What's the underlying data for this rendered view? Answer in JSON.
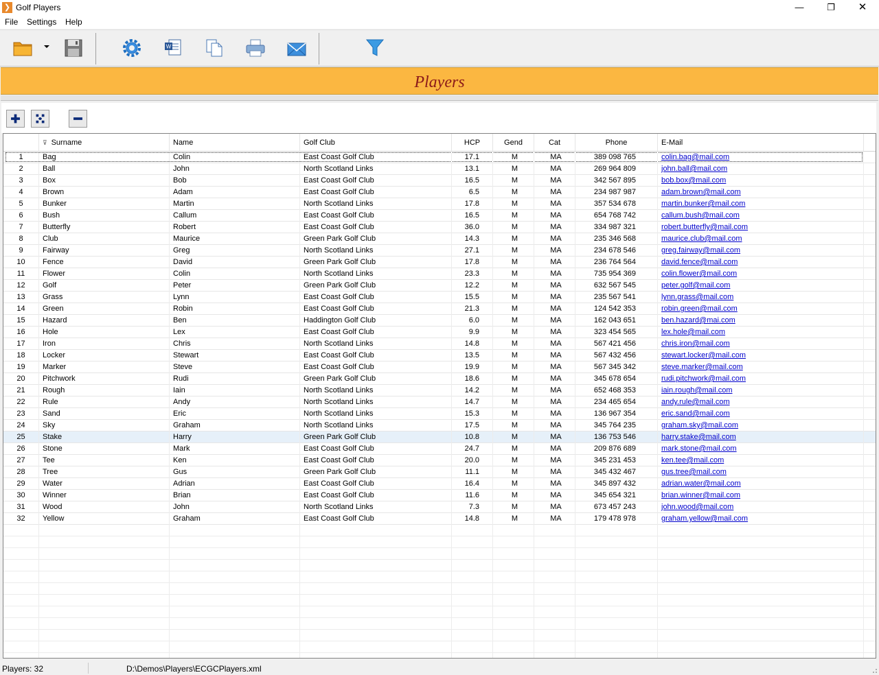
{
  "window": {
    "title": "Golf Players"
  },
  "menu": [
    "File",
    "Settings",
    "Help"
  ],
  "banner": {
    "title": "Players"
  },
  "grid": {
    "columns": {
      "num": "",
      "surname": "Surname",
      "name": "Name",
      "club": "Golf Club",
      "hcp": "HCP",
      "gend": "Gend",
      "cat": "Cat",
      "phone": "Phone",
      "email": "E-Mail"
    },
    "selected_row": 25,
    "focused_row": 1,
    "rows": [
      {
        "num": "1",
        "surname": "Bag",
        "name": "Colin",
        "club": "East Coast Golf Club",
        "hcp": "17.1",
        "gend": "M",
        "cat": "MA",
        "phone": "389 098 765",
        "email": "colin.bag@mail.com"
      },
      {
        "num": "2",
        "surname": "Ball",
        "name": "John",
        "club": "North Scotland Links",
        "hcp": "13.1",
        "gend": "M",
        "cat": "MA",
        "phone": "269 964 809",
        "email": "john.ball@mail.com"
      },
      {
        "num": "3",
        "surname": "Box",
        "name": "Bob",
        "club": "East Coast Golf Club",
        "hcp": "16.5",
        "gend": "M",
        "cat": "MA",
        "phone": "342 567 895",
        "email": "bob.box@mail.com"
      },
      {
        "num": "4",
        "surname": "Brown",
        "name": "Adam",
        "club": "East Coast Golf Club",
        "hcp": "6.5",
        "gend": "M",
        "cat": "MA",
        "phone": "234 987 987",
        "email": "adam.brown@mail.com"
      },
      {
        "num": "5",
        "surname": "Bunker",
        "name": "Martin",
        "club": "North Scotland Links",
        "hcp": "17.8",
        "gend": "M",
        "cat": "MA",
        "phone": "357 534 678",
        "email": "martin.bunker@mail.com"
      },
      {
        "num": "6",
        "surname": "Bush",
        "name": "Callum",
        "club": "East Coast Golf Club",
        "hcp": "16.5",
        "gend": "M",
        "cat": "MA",
        "phone": "654 768 742",
        "email": "callum.bush@mail.com"
      },
      {
        "num": "7",
        "surname": "Butterfly",
        "name": "Robert",
        "club": "East Coast Golf Club",
        "hcp": "36.0",
        "gend": "M",
        "cat": "MA",
        "phone": "334 987 321",
        "email": "robert.butterfly@mail.com"
      },
      {
        "num": "8",
        "surname": "Club",
        "name": "Maurice",
        "club": "Green Park Golf Club",
        "hcp": "14.3",
        "gend": "M",
        "cat": "MA",
        "phone": "235 346 568",
        "email": "maurice.club@mail.com"
      },
      {
        "num": "9",
        "surname": "Fairway",
        "name": "Greg",
        "club": "North Scotland Links",
        "hcp": "27.1",
        "gend": "M",
        "cat": "MA",
        "phone": "234 678 546",
        "email": "greg.fairway@mail.com"
      },
      {
        "num": "10",
        "surname": "Fence",
        "name": "David",
        "club": "Green Park Golf Club",
        "hcp": "17.8",
        "gend": "M",
        "cat": "MA",
        "phone": "236 764 564",
        "email": "david.fence@mail.com"
      },
      {
        "num": "11",
        "surname": "Flower",
        "name": "Colin",
        "club": "North Scotland Links",
        "hcp": "23.3",
        "gend": "M",
        "cat": "MA",
        "phone": "735 954 369",
        "email": "colin.flower@mail.com"
      },
      {
        "num": "12",
        "surname": "Golf",
        "name": "Peter",
        "club": "Green Park Golf Club",
        "hcp": "12.2",
        "gend": "M",
        "cat": "MA",
        "phone": "632 567 545",
        "email": "peter.golf@mail.com"
      },
      {
        "num": "13",
        "surname": "Grass",
        "name": "Lynn",
        "club": "East Coast Golf Club",
        "hcp": "15.5",
        "gend": "M",
        "cat": "MA",
        "phone": "235 567 541",
        "email": "lynn.grass@mail.com"
      },
      {
        "num": "14",
        "surname": "Green",
        "name": "Robin",
        "club": "East Coast Golf Club",
        "hcp": "21.3",
        "gend": "M",
        "cat": "MA",
        "phone": "124 542 353",
        "email": "robin.green@mail.com"
      },
      {
        "num": "15",
        "surname": "Hazard",
        "name": "Ben",
        "club": "Haddington Golf Club",
        "hcp": "6.0",
        "gend": "M",
        "cat": "MA",
        "phone": "162 043 651",
        "email": "ben.hazard@mai.com"
      },
      {
        "num": "16",
        "surname": "Hole",
        "name": "Lex",
        "club": "East Coast Golf Club",
        "hcp": "9.9",
        "gend": "M",
        "cat": "MA",
        "phone": "323 454 565",
        "email": "lex.hole@mail.com"
      },
      {
        "num": "17",
        "surname": "Iron",
        "name": "Chris",
        "club": "North Scotland Links",
        "hcp": "14.8",
        "gend": "M",
        "cat": "MA",
        "phone": "567 421 456",
        "email": "chris.iron@mail.com"
      },
      {
        "num": "18",
        "surname": "Locker",
        "name": "Stewart",
        "club": "East Coast Golf Club",
        "hcp": "13.5",
        "gend": "M",
        "cat": "MA",
        "phone": "567 432 456",
        "email": "stewart.locker@mail.com"
      },
      {
        "num": "19",
        "surname": "Marker",
        "name": "Steve",
        "club": "East Coast Golf Club",
        "hcp": "19.9",
        "gend": "M",
        "cat": "MA",
        "phone": "567 345 342",
        "email": "steve.marker@mail.com"
      },
      {
        "num": "20",
        "surname": "Pitchwork",
        "name": "Rudi",
        "club": "Green Park Golf Club",
        "hcp": "18.6",
        "gend": "M",
        "cat": "MA",
        "phone": "345 678 654",
        "email": "rudi.pitchwork@mail.com"
      },
      {
        "num": "21",
        "surname": "Rough",
        "name": "Iain",
        "club": "North Scotland Links",
        "hcp": "14.2",
        "gend": "M",
        "cat": "MA",
        "phone": "652 468 353",
        "email": "iain.rough@mail.com"
      },
      {
        "num": "22",
        "surname": "Rule",
        "name": "Andy",
        "club": "North Scotland Links",
        "hcp": "14.7",
        "gend": "M",
        "cat": "MA",
        "phone": "234 465 654",
        "email": "andy.rule@mail.com"
      },
      {
        "num": "23",
        "surname": "Sand",
        "name": "Eric",
        "club": "North Scotland Links",
        "hcp": "15.3",
        "gend": "M",
        "cat": "MA",
        "phone": "136 967 354",
        "email": "eric.sand@mail.com"
      },
      {
        "num": "24",
        "surname": "Sky",
        "name": "Graham",
        "club": "North Scotland Links",
        "hcp": "17.5",
        "gend": "M",
        "cat": "MA",
        "phone": "345 764 235",
        "email": "graham.sky@mail.com"
      },
      {
        "num": "25",
        "surname": "Stake",
        "name": "Harry",
        "club": "Green Park Golf Club",
        "hcp": "10.8",
        "gend": "M",
        "cat": "MA",
        "phone": "136 753 546",
        "email": "harry.stake@mail.com"
      },
      {
        "num": "26",
        "surname": "Stone",
        "name": "Mark",
        "club": "East Coast Golf Club",
        "hcp": "24.7",
        "gend": "M",
        "cat": "MA",
        "phone": "209 876 689",
        "email": "mark.stone@mail.com"
      },
      {
        "num": "27",
        "surname": "Tee",
        "name": "Ken",
        "club": "East Coast Golf Club",
        "hcp": "20.0",
        "gend": "M",
        "cat": "MA",
        "phone": "345 231 453",
        "email": "ken.tee@mail.com"
      },
      {
        "num": "28",
        "surname": "Tree",
        "name": "Gus",
        "club": "Green Park Golf Club",
        "hcp": "11.1",
        "gend": "M",
        "cat": "MA",
        "phone": "345 432 467",
        "email": "gus.tree@mail.com"
      },
      {
        "num": "29",
        "surname": "Water",
        "name": "Adrian",
        "club": "East Coast Golf Club",
        "hcp": "16.4",
        "gend": "M",
        "cat": "MA",
        "phone": "345 897 432",
        "email": "adrian.water@mail.com"
      },
      {
        "num": "30",
        "surname": "Winner",
        "name": "Brian",
        "club": "East Coast Golf Club",
        "hcp": "11.6",
        "gend": "M",
        "cat": "MA",
        "phone": "345 654 321",
        "email": "brian.winner@mail.com"
      },
      {
        "num": "31",
        "surname": "Wood",
        "name": "John",
        "club": "North Scotland Links",
        "hcp": "7.3",
        "gend": "M",
        "cat": "MA",
        "phone": "673 457 243",
        "email": "john.wood@mail.com"
      },
      {
        "num": "32",
        "surname": "Yellow",
        "name": "Graham",
        "club": "East Coast Golf Club",
        "hcp": "14.8",
        "gend": "M",
        "cat": "MA",
        "phone": "179 478 978",
        "email": "graham.yellow@mail.com"
      }
    ]
  },
  "status": {
    "count": "Players: 32",
    "path": "D:\\Demos\\Players\\ECGCPlayers.xml"
  },
  "colors": {
    "banner": "#fbb741",
    "banner_text": "#8b1a1a",
    "selected_row": "#e6f0f9",
    "link": "#0000cc"
  }
}
